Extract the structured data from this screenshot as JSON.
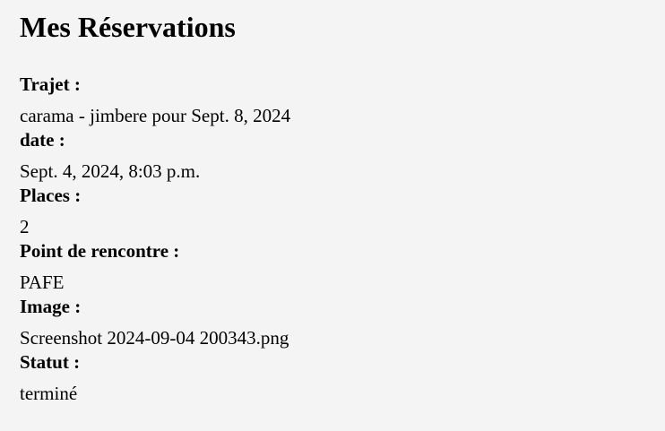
{
  "page": {
    "title": "Mes Réservations"
  },
  "reservation": {
    "trajet_label": "Trajet :",
    "trajet_value": "carama - jimbere pour Sept. 8, 2024",
    "date_label": "date :",
    "date_value": "Sept. 4, 2024, 8:03 p.m.",
    "places_label": "Places :",
    "places_value": "2",
    "rencontre_label": "Point de rencontre :",
    "rencontre_value": "PAFE",
    "image_label": "Image :",
    "image_value": "Screenshot 2024-09-04 200343.png",
    "statut_label": "Statut :",
    "statut_value": "terminé"
  }
}
